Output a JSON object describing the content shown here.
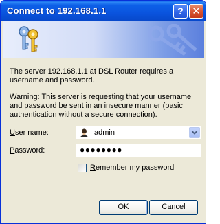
{
  "window": {
    "title": "Connect to 192.168.1.1",
    "help_label": "?",
    "close_label": "✕"
  },
  "message": {
    "line1": "The server 192.168.1.1 at DSL Router requires a username and password.",
    "warning": "Warning: This server is requesting that your username and password be sent in an insecure manner (basic authentication without a secure connection)."
  },
  "form": {
    "username_label_first": "U",
    "username_label_rest": "ser name:",
    "username_value": "admin",
    "password_label_first": "P",
    "password_label_rest": "assword:",
    "password_value": "●●●●●●●●",
    "remember_label_first": "R",
    "remember_label_rest": "emember my password",
    "remember_checked": false
  },
  "buttons": {
    "ok": "OK",
    "cancel": "Cancel"
  },
  "icons": {
    "banner": "keys-icon",
    "user": "user-icon",
    "dropdown": "chevron-down-icon"
  },
  "colors": {
    "titlebar": "#0a54de",
    "dialog_bg": "#ece9d8",
    "close_button": "#d75433"
  }
}
